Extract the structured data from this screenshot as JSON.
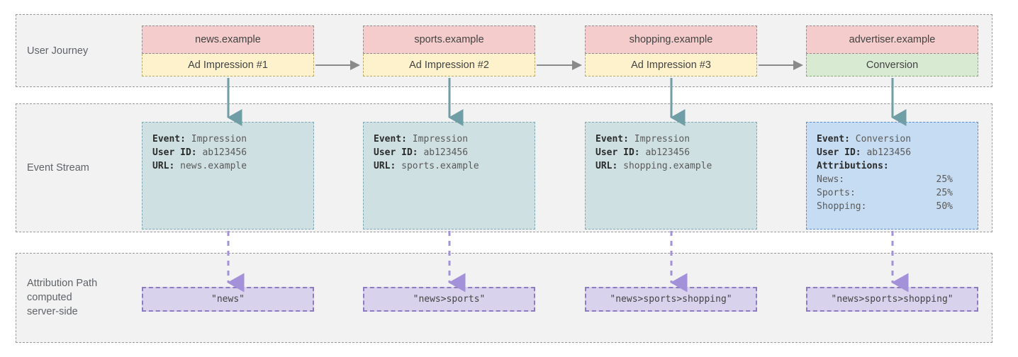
{
  "lanes": [
    {
      "label": "User Journey"
    },
    {
      "label": "Event Stream"
    },
    {
      "label": "Attribution Path\ncomputed\nserver-side"
    }
  ],
  "columns": [
    {
      "site": "news.example",
      "action": "Ad Impression #1",
      "event": {
        "lines": [
          {
            "key": "Event:",
            "value": "Impression"
          },
          {
            "key": "User ID:",
            "value": "ab123456"
          },
          {
            "key": "URL:",
            "value": "news.example"
          }
        ]
      },
      "path": "\"news\""
    },
    {
      "site": "sports.example",
      "action": "Ad Impression #2",
      "event": {
        "lines": [
          {
            "key": "Event:",
            "value": "Impression"
          },
          {
            "key": "User ID:",
            "value": "ab123456"
          },
          {
            "key": "URL:",
            "value": "sports.example"
          }
        ]
      },
      "path": "\"news>sports\""
    },
    {
      "site": "shopping.example",
      "action": "Ad Impression #3",
      "event": {
        "lines": [
          {
            "key": "Event:",
            "value": "Impression"
          },
          {
            "key": "User ID:",
            "value": "ab123456"
          },
          {
            "key": "URL:",
            "value": "shopping.example"
          }
        ]
      },
      "path": "\"news>sports>shopping\""
    },
    {
      "site": "advertiser.example",
      "action": "Conversion",
      "event": {
        "lines": [
          {
            "key": "Event:",
            "value": "Conversion"
          },
          {
            "key": "User ID:",
            "value": "ab123456"
          },
          {
            "key": "Attributions:",
            "value": ""
          }
        ],
        "attributions": [
          {
            "name": "News:",
            "value": "25%"
          },
          {
            "name": "Sports:",
            "value": "25%"
          },
          {
            "name": "Shopping:",
            "value": "50%"
          }
        ]
      },
      "path": "\"news>sports>shopping\""
    }
  ],
  "colors": {
    "lane_fill": "#f2f2f2",
    "lane_border": "#9a9a9a",
    "site_fill": "#f4cccc",
    "impression_fill": "#fdf2cc",
    "conversion_fill": "#d9ead3",
    "event_fill": "#cfe0e2",
    "conversion_event_fill": "#c6dcf2",
    "path_fill": "#d9d2ec",
    "path_border": "#8e7cc3",
    "flow_arrow": "#8a8a8a",
    "event_arrow": "#6f9ea6",
    "path_arrow": "#a391d9"
  }
}
